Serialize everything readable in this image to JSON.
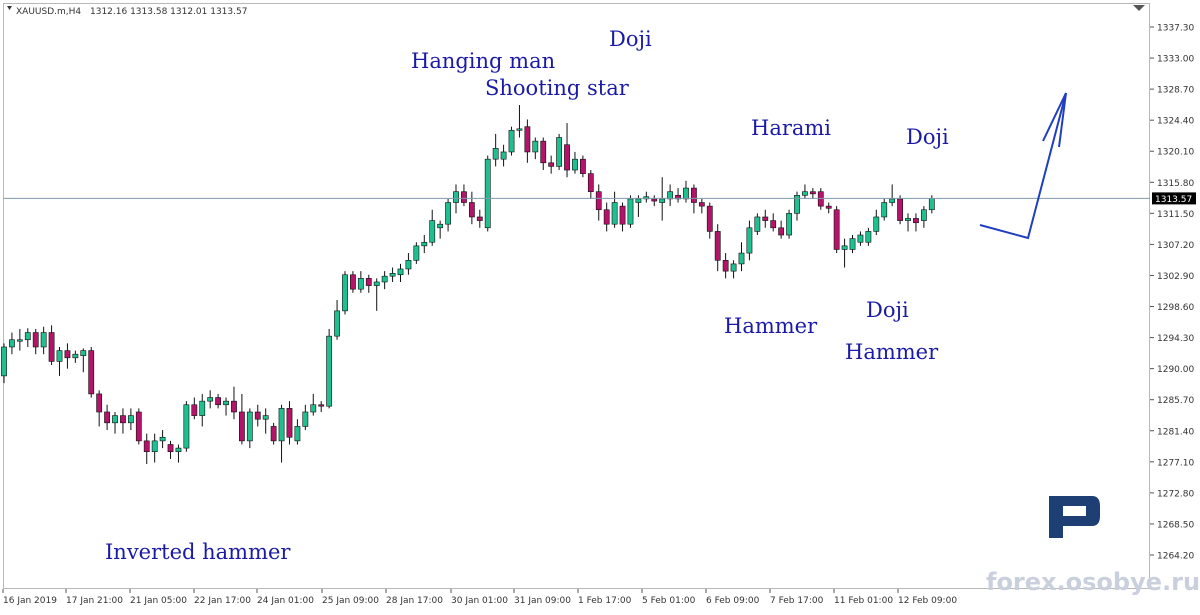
{
  "header": {
    "symbol": "XAUUSD.m,H4",
    "ohlc": "1312.16 1313.58 1312.01 1313.57"
  },
  "watermark": "forex.osobye.ru",
  "logo_icon": "roboforex-r-logo",
  "colors": {
    "bull": "#1fbf8f",
    "bear": "#b5126a",
    "annotation": "#1a1aa6",
    "price_line": "#7f9ab0",
    "arrow": "#1f3fc0"
  },
  "chart_data": {
    "type": "candlestick",
    "timeframe": "H4",
    "current_price": "1313.57",
    "ylim": [
      1264.2,
      1340.0
    ],
    "y_ticks": [
      "1337.30",
      "1333.00",
      "1328.70",
      "1324.40",
      "1320.10",
      "1315.80",
      "1311.50",
      "1307.20",
      "1302.90",
      "1298.60",
      "1294.30",
      "1290.00",
      "1285.70",
      "1281.40",
      "1277.10",
      "1272.80",
      "1268.50",
      "1264.20"
    ],
    "x_labels": [
      "16 Jan 2019",
      "17 Jan 21:00",
      "21 Jan 05:00",
      "22 Jan 17:00",
      "24 Jan 01:00",
      "25 Jan 09:00",
      "28 Jan 17:00",
      "30 Jan 01:00",
      "31 Jan 09:00",
      "1 Feb 17:00",
      "5 Feb 01:00",
      "6 Feb 09:00",
      "7 Feb 17:00",
      "11 Feb 01:00",
      "12 Feb 09:00"
    ],
    "candles": [
      {
        "o": 1289.0,
        "h": 1293.5,
        "l": 1288.0,
        "c": 1293.0
      },
      {
        "o": 1293.0,
        "h": 1295.0,
        "l": 1292.0,
        "c": 1294.0
      },
      {
        "o": 1293.8,
        "h": 1295.5,
        "l": 1292.5,
        "c": 1294.0
      },
      {
        "o": 1294.0,
        "h": 1295.6,
        "l": 1293.0,
        "c": 1295.0
      },
      {
        "o": 1295.0,
        "h": 1295.5,
        "l": 1292.0,
        "c": 1293.0
      },
      {
        "o": 1293.0,
        "h": 1295.8,
        "l": 1292.0,
        "c": 1295.0
      },
      {
        "o": 1295.0,
        "h": 1296.0,
        "l": 1290.5,
        "c": 1291.0
      },
      {
        "o": 1291.0,
        "h": 1293.0,
        "l": 1289.0,
        "c": 1292.5
      },
      {
        "o": 1292.5,
        "h": 1293.5,
        "l": 1290.0,
        "c": 1291.5
      },
      {
        "o": 1291.5,
        "h": 1292.5,
        "l": 1290.8,
        "c": 1292.0
      },
      {
        "o": 1291.8,
        "h": 1292.8,
        "l": 1289.5,
        "c": 1292.5
      },
      {
        "o": 1292.5,
        "h": 1293.0,
        "l": 1286.0,
        "c": 1286.5
      },
      {
        "o": 1286.5,
        "h": 1287.0,
        "l": 1282.0,
        "c": 1284.0
      },
      {
        "o": 1284.0,
        "h": 1285.0,
        "l": 1281.5,
        "c": 1282.5
      },
      {
        "o": 1282.5,
        "h": 1284.0,
        "l": 1281.0,
        "c": 1283.5
      },
      {
        "o": 1283.5,
        "h": 1284.5,
        "l": 1281.0,
        "c": 1282.5
      },
      {
        "o": 1282.5,
        "h": 1284.5,
        "l": 1281.5,
        "c": 1283.5
      },
      {
        "o": 1284.0,
        "h": 1284.5,
        "l": 1279.5,
        "c": 1280.0
      },
      {
        "o": 1280.0,
        "h": 1281.0,
        "l": 1276.8,
        "c": 1278.5
      },
      {
        "o": 1278.5,
        "h": 1281.0,
        "l": 1277.0,
        "c": 1280.0
      },
      {
        "o": 1280.0,
        "h": 1281.5,
        "l": 1279.0,
        "c": 1280.5
      },
      {
        "o": 1279.5,
        "h": 1280.0,
        "l": 1277.5,
        "c": 1278.5
      },
      {
        "o": 1278.5,
        "h": 1279.5,
        "l": 1277.0,
        "c": 1279.0
      },
      {
        "o": 1279.0,
        "h": 1285.5,
        "l": 1278.5,
        "c": 1285.0
      },
      {
        "o": 1285.0,
        "h": 1286.0,
        "l": 1283.0,
        "c": 1283.5
      },
      {
        "o": 1283.5,
        "h": 1286.5,
        "l": 1282.0,
        "c": 1285.5
      },
      {
        "o": 1285.5,
        "h": 1287.0,
        "l": 1284.5,
        "c": 1286.0
      },
      {
        "o": 1286.0,
        "h": 1286.5,
        "l": 1284.5,
        "c": 1285.0
      },
      {
        "o": 1285.0,
        "h": 1286.0,
        "l": 1283.5,
        "c": 1285.5
      },
      {
        "o": 1285.5,
        "h": 1287.5,
        "l": 1283.0,
        "c": 1284.0
      },
      {
        "o": 1284.0,
        "h": 1286.5,
        "l": 1279.5,
        "c": 1280.0
      },
      {
        "o": 1280.0,
        "h": 1284.5,
        "l": 1279.0,
        "c": 1284.0
      },
      {
        "o": 1284.0,
        "h": 1285.0,
        "l": 1282.0,
        "c": 1283.0
      },
      {
        "o": 1283.0,
        "h": 1284.5,
        "l": 1281.0,
        "c": 1283.5
      },
      {
        "o": 1282.0,
        "h": 1282.5,
        "l": 1279.5,
        "c": 1280.0
      },
      {
        "o": 1280.0,
        "h": 1285.0,
        "l": 1277.0,
        "c": 1284.5
      },
      {
        "o": 1284.5,
        "h": 1285.5,
        "l": 1279.5,
        "c": 1280.5
      },
      {
        "o": 1280.0,
        "h": 1283.0,
        "l": 1279.5,
        "c": 1282.0
      },
      {
        "o": 1282.0,
        "h": 1285.0,
        "l": 1281.5,
        "c": 1284.0
      },
      {
        "o": 1284.0,
        "h": 1286.5,
        "l": 1283.5,
        "c": 1285.0
      },
      {
        "o": 1285.0,
        "h": 1285.5,
        "l": 1284.0,
        "c": 1284.8
      },
      {
        "o": 1284.8,
        "h": 1295.5,
        "l": 1284.5,
        "c": 1294.5
      },
      {
        "o": 1294.5,
        "h": 1299.5,
        "l": 1294.0,
        "c": 1298.0
      },
      {
        "o": 1298.0,
        "h": 1303.5,
        "l": 1297.5,
        "c": 1303.0
      },
      {
        "o": 1303.0,
        "h": 1303.5,
        "l": 1300.5,
        "c": 1301.0
      },
      {
        "o": 1301.0,
        "h": 1303.5,
        "l": 1300.5,
        "c": 1302.5
      },
      {
        "o": 1302.5,
        "h": 1303.0,
        "l": 1300.5,
        "c": 1301.5
      },
      {
        "o": 1301.5,
        "h": 1302.5,
        "l": 1298.0,
        "c": 1302.0
      },
      {
        "o": 1302.0,
        "h": 1303.5,
        "l": 1301.0,
        "c": 1302.8
      },
      {
        "o": 1302.8,
        "h": 1304.0,
        "l": 1302.0,
        "c": 1303.2
      },
      {
        "o": 1303.0,
        "h": 1304.5,
        "l": 1302.0,
        "c": 1303.8
      },
      {
        "o": 1303.8,
        "h": 1306.0,
        "l": 1303.0,
        "c": 1305.0
      },
      {
        "o": 1305.0,
        "h": 1307.5,
        "l": 1304.5,
        "c": 1307.0
      },
      {
        "o": 1307.0,
        "h": 1308.5,
        "l": 1306.0,
        "c": 1307.5
      },
      {
        "o": 1307.5,
        "h": 1312.0,
        "l": 1307.0,
        "c": 1310.5
      },
      {
        "o": 1309.5,
        "h": 1310.5,
        "l": 1308.0,
        "c": 1310.0
      },
      {
        "o": 1310.0,
        "h": 1313.5,
        "l": 1309.0,
        "c": 1313.0
      },
      {
        "o": 1313.0,
        "h": 1315.5,
        "l": 1311.5,
        "c": 1314.5
      },
      {
        "o": 1314.5,
        "h": 1315.5,
        "l": 1312.5,
        "c": 1313.0
      },
      {
        "o": 1313.0,
        "h": 1314.5,
        "l": 1310.0,
        "c": 1311.0
      },
      {
        "o": 1311.0,
        "h": 1312.0,
        "l": 1309.5,
        "c": 1310.5
      },
      {
        "o": 1309.5,
        "h": 1319.5,
        "l": 1309.0,
        "c": 1319.0
      },
      {
        "o": 1319.0,
        "h": 1322.5,
        "l": 1318.0,
        "c": 1320.5
      },
      {
        "o": 1319.0,
        "h": 1321.0,
        "l": 1318.0,
        "c": 1320.0
      },
      {
        "o": 1320.0,
        "h": 1323.5,
        "l": 1319.5,
        "c": 1323.0
      },
      {
        "o": 1323.0,
        "h": 1326.5,
        "l": 1322.0,
        "c": 1323.2
      },
      {
        "o": 1323.5,
        "h": 1324.5,
        "l": 1318.5,
        "c": 1320.0
      },
      {
        "o": 1320.0,
        "h": 1322.0,
        "l": 1319.0,
        "c": 1321.5
      },
      {
        "o": 1321.5,
        "h": 1322.0,
        "l": 1317.5,
        "c": 1318.5
      },
      {
        "o": 1318.5,
        "h": 1319.5,
        "l": 1317.0,
        "c": 1318.0
      },
      {
        "o": 1318.0,
        "h": 1322.5,
        "l": 1317.5,
        "c": 1322.0
      },
      {
        "o": 1321.0,
        "h": 1324.0,
        "l": 1316.5,
        "c": 1317.5
      },
      {
        "o": 1317.5,
        "h": 1320.0,
        "l": 1317.0,
        "c": 1319.0
      },
      {
        "o": 1319.0,
        "h": 1319.5,
        "l": 1316.5,
        "c": 1317.0
      },
      {
        "o": 1317.0,
        "h": 1317.5,
        "l": 1313.5,
        "c": 1314.5
      },
      {
        "o": 1314.5,
        "h": 1315.5,
        "l": 1310.5,
        "c": 1312.0
      },
      {
        "o": 1312.0,
        "h": 1313.0,
        "l": 1309.0,
        "c": 1310.0
      },
      {
        "o": 1310.0,
        "h": 1314.5,
        "l": 1309.5,
        "c": 1313.0
      },
      {
        "o": 1312.5,
        "h": 1313.0,
        "l": 1309.0,
        "c": 1310.0
      },
      {
        "o": 1310.0,
        "h": 1314.0,
        "l": 1309.5,
        "c": 1313.5
      },
      {
        "o": 1313.0,
        "h": 1314.0,
        "l": 1311.0,
        "c": 1313.5
      },
      {
        "o": 1313.5,
        "h": 1314.5,
        "l": 1313.0,
        "c": 1313.8
      },
      {
        "o": 1313.5,
        "h": 1314.0,
        "l": 1312.5,
        "c": 1313.2
      },
      {
        "o": 1313.0,
        "h": 1316.5,
        "l": 1310.5,
        "c": 1313.5
      },
      {
        "o": 1313.5,
        "h": 1315.5,
        "l": 1312.5,
        "c": 1314.5
      },
      {
        "o": 1314.0,
        "h": 1315.0,
        "l": 1313.0,
        "c": 1313.5
      },
      {
        "o": 1313.5,
        "h": 1316.0,
        "l": 1313.0,
        "c": 1315.0
      },
      {
        "o": 1315.0,
        "h": 1315.5,
        "l": 1311.5,
        "c": 1313.0
      },
      {
        "o": 1313.0,
        "h": 1313.5,
        "l": 1311.5,
        "c": 1312.5
      },
      {
        "o": 1312.5,
        "h": 1313.0,
        "l": 1308.0,
        "c": 1309.0
      },
      {
        "o": 1309.0,
        "h": 1310.0,
        "l": 1303.5,
        "c": 1305.0
      },
      {
        "o": 1305.0,
        "h": 1306.0,
        "l": 1302.5,
        "c": 1303.5
      },
      {
        "o": 1303.5,
        "h": 1305.0,
        "l": 1302.5,
        "c": 1304.5
      },
      {
        "o": 1304.5,
        "h": 1307.5,
        "l": 1303.5,
        "c": 1306.0
      },
      {
        "o": 1306.0,
        "h": 1310.5,
        "l": 1305.0,
        "c": 1309.5
      },
      {
        "o": 1309.0,
        "h": 1311.5,
        "l": 1308.5,
        "c": 1311.0
      },
      {
        "o": 1311.0,
        "h": 1312.0,
        "l": 1309.5,
        "c": 1310.5
      },
      {
        "o": 1310.5,
        "h": 1311.5,
        "l": 1309.0,
        "c": 1309.5
      },
      {
        "o": 1309.5,
        "h": 1310.5,
        "l": 1308.0,
        "c": 1308.5
      },
      {
        "o": 1308.5,
        "h": 1312.0,
        "l": 1308.0,
        "c": 1311.5
      },
      {
        "o": 1311.5,
        "h": 1314.5,
        "l": 1310.5,
        "c": 1314.0
      },
      {
        "o": 1314.0,
        "h": 1315.5,
        "l": 1313.5,
        "c": 1314.5
      },
      {
        "o": 1314.5,
        "h": 1315.0,
        "l": 1313.5,
        "c": 1314.2
      },
      {
        "o": 1314.5,
        "h": 1315.0,
        "l": 1312.0,
        "c": 1312.5
      },
      {
        "o": 1312.5,
        "h": 1313.0,
        "l": 1311.5,
        "c": 1312.2
      },
      {
        "o": 1312.0,
        "h": 1312.5,
        "l": 1306.0,
        "c": 1306.5
      },
      {
        "o": 1306.5,
        "h": 1308.0,
        "l": 1304.0,
        "c": 1307.0
      },
      {
        "o": 1306.5,
        "h": 1308.5,
        "l": 1306.0,
        "c": 1308.0
      },
      {
        "o": 1307.5,
        "h": 1309.0,
        "l": 1307.0,
        "c": 1308.5
      },
      {
        "o": 1307.5,
        "h": 1309.5,
        "l": 1307.0,
        "c": 1309.0
      },
      {
        "o": 1309.0,
        "h": 1312.0,
        "l": 1308.5,
        "c": 1311.0
      },
      {
        "o": 1311.0,
        "h": 1313.5,
        "l": 1310.5,
        "c": 1313.0
      },
      {
        "o": 1313.0,
        "h": 1315.5,
        "l": 1312.5,
        "c": 1313.5
      },
      {
        "o": 1313.5,
        "h": 1314.0,
        "l": 1310.0,
        "c": 1310.5
      },
      {
        "o": 1310.5,
        "h": 1311.5,
        "l": 1309.0,
        "c": 1310.8
      },
      {
        "o": 1310.8,
        "h": 1311.5,
        "l": 1309.0,
        "c": 1310.2
      },
      {
        "o": 1310.5,
        "h": 1312.5,
        "l": 1309.5,
        "c": 1312.0
      },
      {
        "o": 1312.0,
        "h": 1314.0,
        "l": 1311.5,
        "c": 1313.57
      }
    ],
    "annotations": [
      "Hanging man",
      "Shooting star",
      "Doji",
      "Harami",
      "Doji",
      "Doji",
      "Hammer",
      "Hammer",
      "Inverted hammer"
    ]
  }
}
